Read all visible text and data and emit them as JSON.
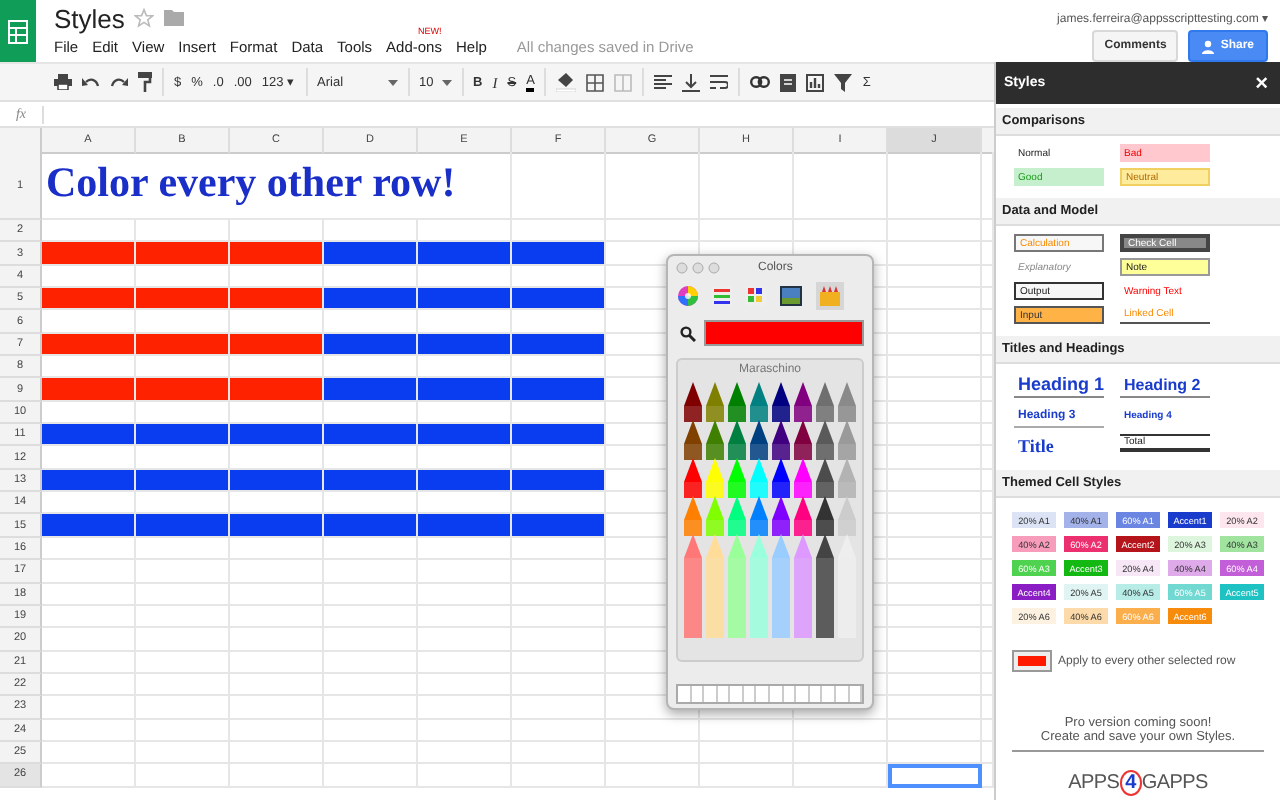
{
  "app": {
    "title": "Styles",
    "menu": [
      {
        "label": "File"
      },
      {
        "label": "Edit"
      },
      {
        "label": "View"
      },
      {
        "label": "Insert"
      },
      {
        "label": "Format"
      },
      {
        "label": "Data"
      },
      {
        "label": "Tools"
      },
      {
        "label": "Add-ons",
        "badge": "NEW!"
      },
      {
        "label": "Help"
      }
    ],
    "save_status": "All changes saved in Drive",
    "account": "james.ferreira@appsscripttesting.com ▾",
    "buttons": [
      "Comments",
      "Share"
    ]
  },
  "toolbar": {
    "number_formats": [
      "$",
      "%",
      ".0",
      ".00",
      "123 ▾"
    ],
    "font": "Arial",
    "font_size": "10",
    "text_styles": [
      "B",
      "I",
      "S",
      "A"
    ],
    "functions": "Σ"
  },
  "formula_bar": {
    "label": "fx"
  },
  "sheet": {
    "columns": [
      {
        "label": "A",
        "selected": false
      },
      {
        "label": "B",
        "selected": false
      },
      {
        "label": "C",
        "selected": false
      },
      {
        "label": "D",
        "selected": false
      },
      {
        "label": "E",
        "selected": false
      },
      {
        "label": "F",
        "selected": false
      },
      {
        "label": "G",
        "selected": false
      },
      {
        "label": "H",
        "selected": false
      },
      {
        "label": "I",
        "selected": false
      },
      {
        "label": "J",
        "selected": true
      }
    ],
    "rows": [
      {
        "label": "1",
        "selected": false,
        "title": "Color every other row!"
      },
      {
        "label": "2",
        "selected": false
      },
      {
        "label": "3",
        "selected": false,
        "cells": [
          {
            "color": "#ff2200"
          },
          {
            "color": "#ff2200"
          },
          {
            "color": "#ff2200"
          },
          {
            "color": "#0a3cf0"
          },
          {
            "color": "#0a3cf0"
          },
          {
            "color": "#0a3cf0"
          }
        ]
      },
      {
        "label": "4",
        "selected": false
      },
      {
        "label": "5",
        "selected": false,
        "cells": [
          {
            "color": "#ff2200"
          },
          {
            "color": "#ff2200"
          },
          {
            "color": "#ff2200"
          },
          {
            "color": "#0a3cf0"
          },
          {
            "color": "#0a3cf0"
          },
          {
            "color": "#0a3cf0"
          }
        ]
      },
      {
        "label": "6",
        "selected": false
      },
      {
        "label": "7",
        "selected": false,
        "cells": [
          {
            "color": "#ff2200"
          },
          {
            "color": "#ff2200"
          },
          {
            "color": "#ff2200"
          },
          {
            "color": "#0a3cf0"
          },
          {
            "color": "#0a3cf0"
          },
          {
            "color": "#0a3cf0"
          }
        ]
      },
      {
        "label": "8",
        "selected": false
      },
      {
        "label": "9",
        "selected": false,
        "cells": [
          {
            "color": "#ff2200"
          },
          {
            "color": "#ff2200"
          },
          {
            "color": "#ff2200"
          },
          {
            "color": "#0a3cf0"
          },
          {
            "color": "#0a3cf0"
          },
          {
            "color": "#0a3cf0"
          }
        ]
      },
      {
        "label": "10",
        "selected": false
      },
      {
        "label": "11",
        "selected": false,
        "cells": [
          {
            "color": "#0a3cf0"
          },
          {
            "color": "#0a3cf0"
          },
          {
            "color": "#0a3cf0"
          },
          {
            "color": "#0a3cf0"
          },
          {
            "color": "#0a3cf0"
          },
          {
            "color": "#0a3cf0"
          }
        ]
      },
      {
        "label": "12",
        "selected": false
      },
      {
        "label": "13",
        "selected": false,
        "cells": [
          {
            "color": "#0a3cf0"
          },
          {
            "color": "#0a3cf0"
          },
          {
            "color": "#0a3cf0"
          },
          {
            "color": "#0a3cf0"
          },
          {
            "color": "#0a3cf0"
          },
          {
            "color": "#0a3cf0"
          }
        ]
      },
      {
        "label": "14",
        "selected": false
      },
      {
        "label": "15",
        "selected": false,
        "cells": [
          {
            "color": "#0a3cf0"
          },
          {
            "color": "#0a3cf0"
          },
          {
            "color": "#0a3cf0"
          },
          {
            "color": "#0a3cf0"
          },
          {
            "color": "#0a3cf0"
          },
          {
            "color": "#0a3cf0"
          }
        ]
      },
      {
        "label": "16",
        "selected": false
      },
      {
        "label": "17",
        "selected": false
      },
      {
        "label": "18",
        "selected": false
      },
      {
        "label": "19",
        "selected": false
      },
      {
        "label": "20",
        "selected": false
      },
      {
        "label": "21",
        "selected": false
      },
      {
        "label": "22",
        "selected": false
      },
      {
        "label": "23",
        "selected": false
      },
      {
        "label": "24",
        "selected": false
      },
      {
        "label": "25",
        "selected": false
      },
      {
        "label": "26",
        "selected": true
      }
    ]
  },
  "color_picker": {
    "title": "Colors",
    "color": "#ff0000",
    "crayon_name": "Maraschino"
  },
  "sidebar": {
    "title": "Styles",
    "close": "×",
    "sections": [
      {
        "heading": "Comparisons",
        "styles": [
          {
            "label": "Normal",
            "kind": "normal"
          },
          {
            "label": "Bad",
            "kind": "bad"
          },
          {
            "label": "Good",
            "kind": "good"
          },
          {
            "label": "Neutral",
            "kind": "neutral"
          }
        ]
      },
      {
        "heading": "Data and Model",
        "styles": [
          {
            "label": "Calculation",
            "kind": "calculation"
          },
          {
            "label": "Check Cell",
            "kind": "check"
          },
          {
            "label": "Explanatory",
            "kind": "explanatory"
          },
          {
            "label": "Note",
            "kind": "note"
          },
          {
            "label": "Output",
            "kind": "output"
          },
          {
            "label": "Warning Text",
            "kind": "warning"
          },
          {
            "label": "Input",
            "kind": "input"
          },
          {
            "label": "Linked Cell",
            "kind": "linked"
          }
        ]
      },
      {
        "heading": "Titles and Headings",
        "styles": [
          {
            "label": "Heading 1",
            "kind": "heading1"
          },
          {
            "label": "Heading 2",
            "kind": "heading2"
          },
          {
            "label": "Heading 3",
            "kind": "heading3"
          },
          {
            "label": "Heading 4",
            "kind": "heading4"
          },
          {
            "label": "Title",
            "kind": "title"
          },
          {
            "label": "Total",
            "kind": "total"
          }
        ]
      },
      {
        "heading": "Themed Cell Styles",
        "chips": [
          {
            "label": "20% A1",
            "kind": "tint",
            "color": "#dce3f5"
          },
          {
            "label": "40% A1",
            "kind": "tint",
            "color": "#a3b3ea"
          },
          {
            "label": "60% A1",
            "kind": "solid",
            "color": "#6a86e2"
          },
          {
            "label": "Accent1",
            "kind": "solid",
            "color": "#1a3ccc"
          },
          {
            "label": "20% A2",
            "kind": "tint",
            "color": "#fde6ee"
          },
          {
            "label": "40% A2",
            "kind": "tint",
            "color": "#f79cbb"
          },
          {
            "label": "60% A2",
            "kind": "solid",
            "color": "#ec2f6e"
          },
          {
            "label": "Accent2",
            "kind": "solid",
            "color": "#b5141a"
          },
          {
            "label": "20% A3",
            "kind": "tint",
            "color": "#ddf5dd"
          },
          {
            "label": "40% A3",
            "kind": "tint",
            "color": "#a0e4a0"
          },
          {
            "label": "60% A3",
            "kind": "solid",
            "color": "#4fd24f"
          },
          {
            "label": "Accent3",
            "kind": "solid",
            "color": "#13b813"
          },
          {
            "label": "20% A4",
            "kind": "tint",
            "color": "#f6e6f6"
          },
          {
            "label": "40% A4",
            "kind": "tint",
            "color": "#dfaaea"
          },
          {
            "label": "60% A4",
            "kind": "solid",
            "color": "#c25ed8"
          },
          {
            "label": "Accent4",
            "kind": "solid",
            "color": "#8a1ec4"
          },
          {
            "label": "20% A5",
            "kind": "tint",
            "color": "#e0f5f3"
          },
          {
            "label": "40% A5",
            "kind": "tint",
            "color": "#b7ece7"
          },
          {
            "label": "60% A5",
            "kind": "solid",
            "color": "#72d8d2"
          },
          {
            "label": "Accent5",
            "kind": "solid",
            "color": "#1ec2c2"
          },
          {
            "label": "20% A6",
            "kind": "tint",
            "color": "#fdf1e1"
          },
          {
            "label": "40% A6",
            "kind": "tint",
            "color": "#fcdaa9"
          },
          {
            "label": "60% A6",
            "kind": "solid",
            "color": "#fbae4c"
          },
          {
            "label": "Accent6",
            "kind": "solid",
            "color": "#f78c0c"
          }
        ]
      }
    ],
    "apply": {
      "color": "#ff1a00",
      "label": "Apply to every other selected row"
    },
    "promo": [
      "Pro version coming soon!",
      "Create and save your own Styles."
    ],
    "logo": [
      "APPS",
      "4",
      "GAPPS"
    ]
  }
}
